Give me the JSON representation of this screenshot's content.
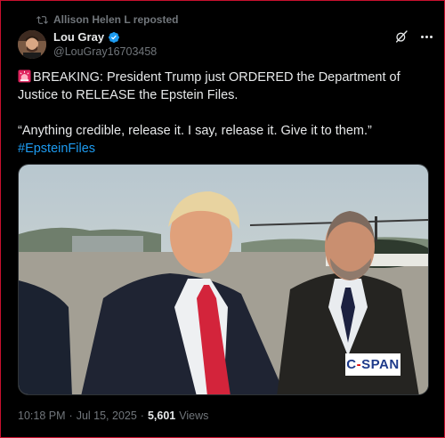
{
  "repost": {
    "icon": "repost-icon",
    "text": "Allison Helen L reposted"
  },
  "author": {
    "name": "Lou Gray",
    "handle": "@LouGray16703458",
    "verified": true,
    "verified_color": "#1d9bf0"
  },
  "tweet": {
    "line1": "BREAKING: President Trump just ORDERED the Department of Justice to RELEASE the Epstein Files.",
    "line2": "“Anything credible, release it. I say, release it. Give it to them.”",
    "hashtag": "#EpsteinFiles",
    "emoji_icon": "siren-icon"
  },
  "media": {
    "badge": "C-SPAN"
  },
  "meta": {
    "time": "10:18 PM",
    "date": "Jul 15, 2025",
    "separator": "·",
    "views_count": "5,601",
    "views_label": "Views"
  },
  "colors": {
    "accent": "#1d9bf0",
    "muted": "#71767b",
    "text": "#e7e9ea",
    "background": "#000000"
  }
}
